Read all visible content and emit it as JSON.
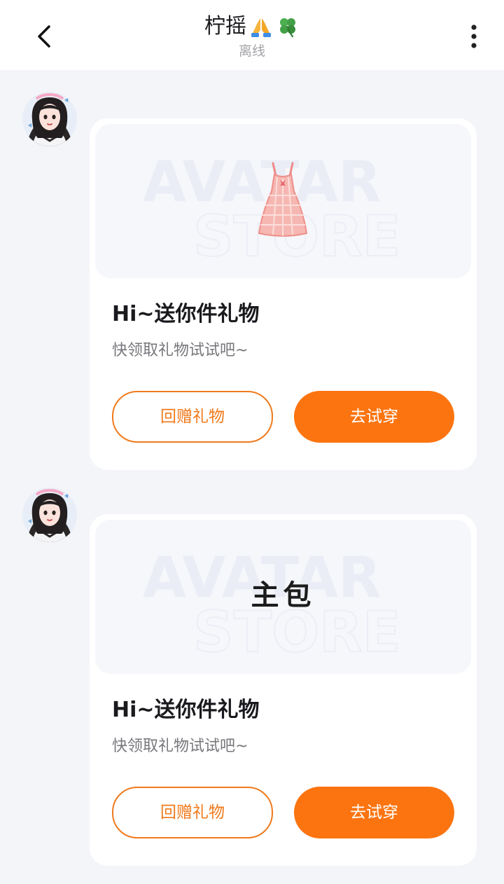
{
  "header": {
    "title": "柠摇",
    "title_emoji": [
      "praying-hands-icon",
      "four-leaf-clover-icon"
    ],
    "status": "离线",
    "back_icon": "chevron-left-icon",
    "more_icon": "more-vertical-icon"
  },
  "messages": [
    {
      "avatar": "avatar-girl",
      "preview_kind": "image",
      "preview_image": "pink-dress",
      "watermark": [
        "AVATAR",
        "STORE"
      ],
      "title": "Hi~送你件礼物",
      "subtitle": "快领取礼物试试吧~",
      "return_gift_label": "回赠礼物",
      "try_on_label": "去试穿"
    },
    {
      "avatar": "avatar-girl",
      "preview_kind": "text",
      "preview_text": "主包",
      "watermark": [
        "AVATAR",
        "STORE"
      ],
      "title": "Hi~送你件礼物",
      "subtitle": "快领取礼物试试吧~",
      "return_gift_label": "回赠礼物",
      "try_on_label": "去试穿"
    }
  ],
  "colors": {
    "accent": "#fb7410",
    "accent_outline": "#f07a1c",
    "background": "#f4f5f9",
    "card": "#ffffff"
  }
}
